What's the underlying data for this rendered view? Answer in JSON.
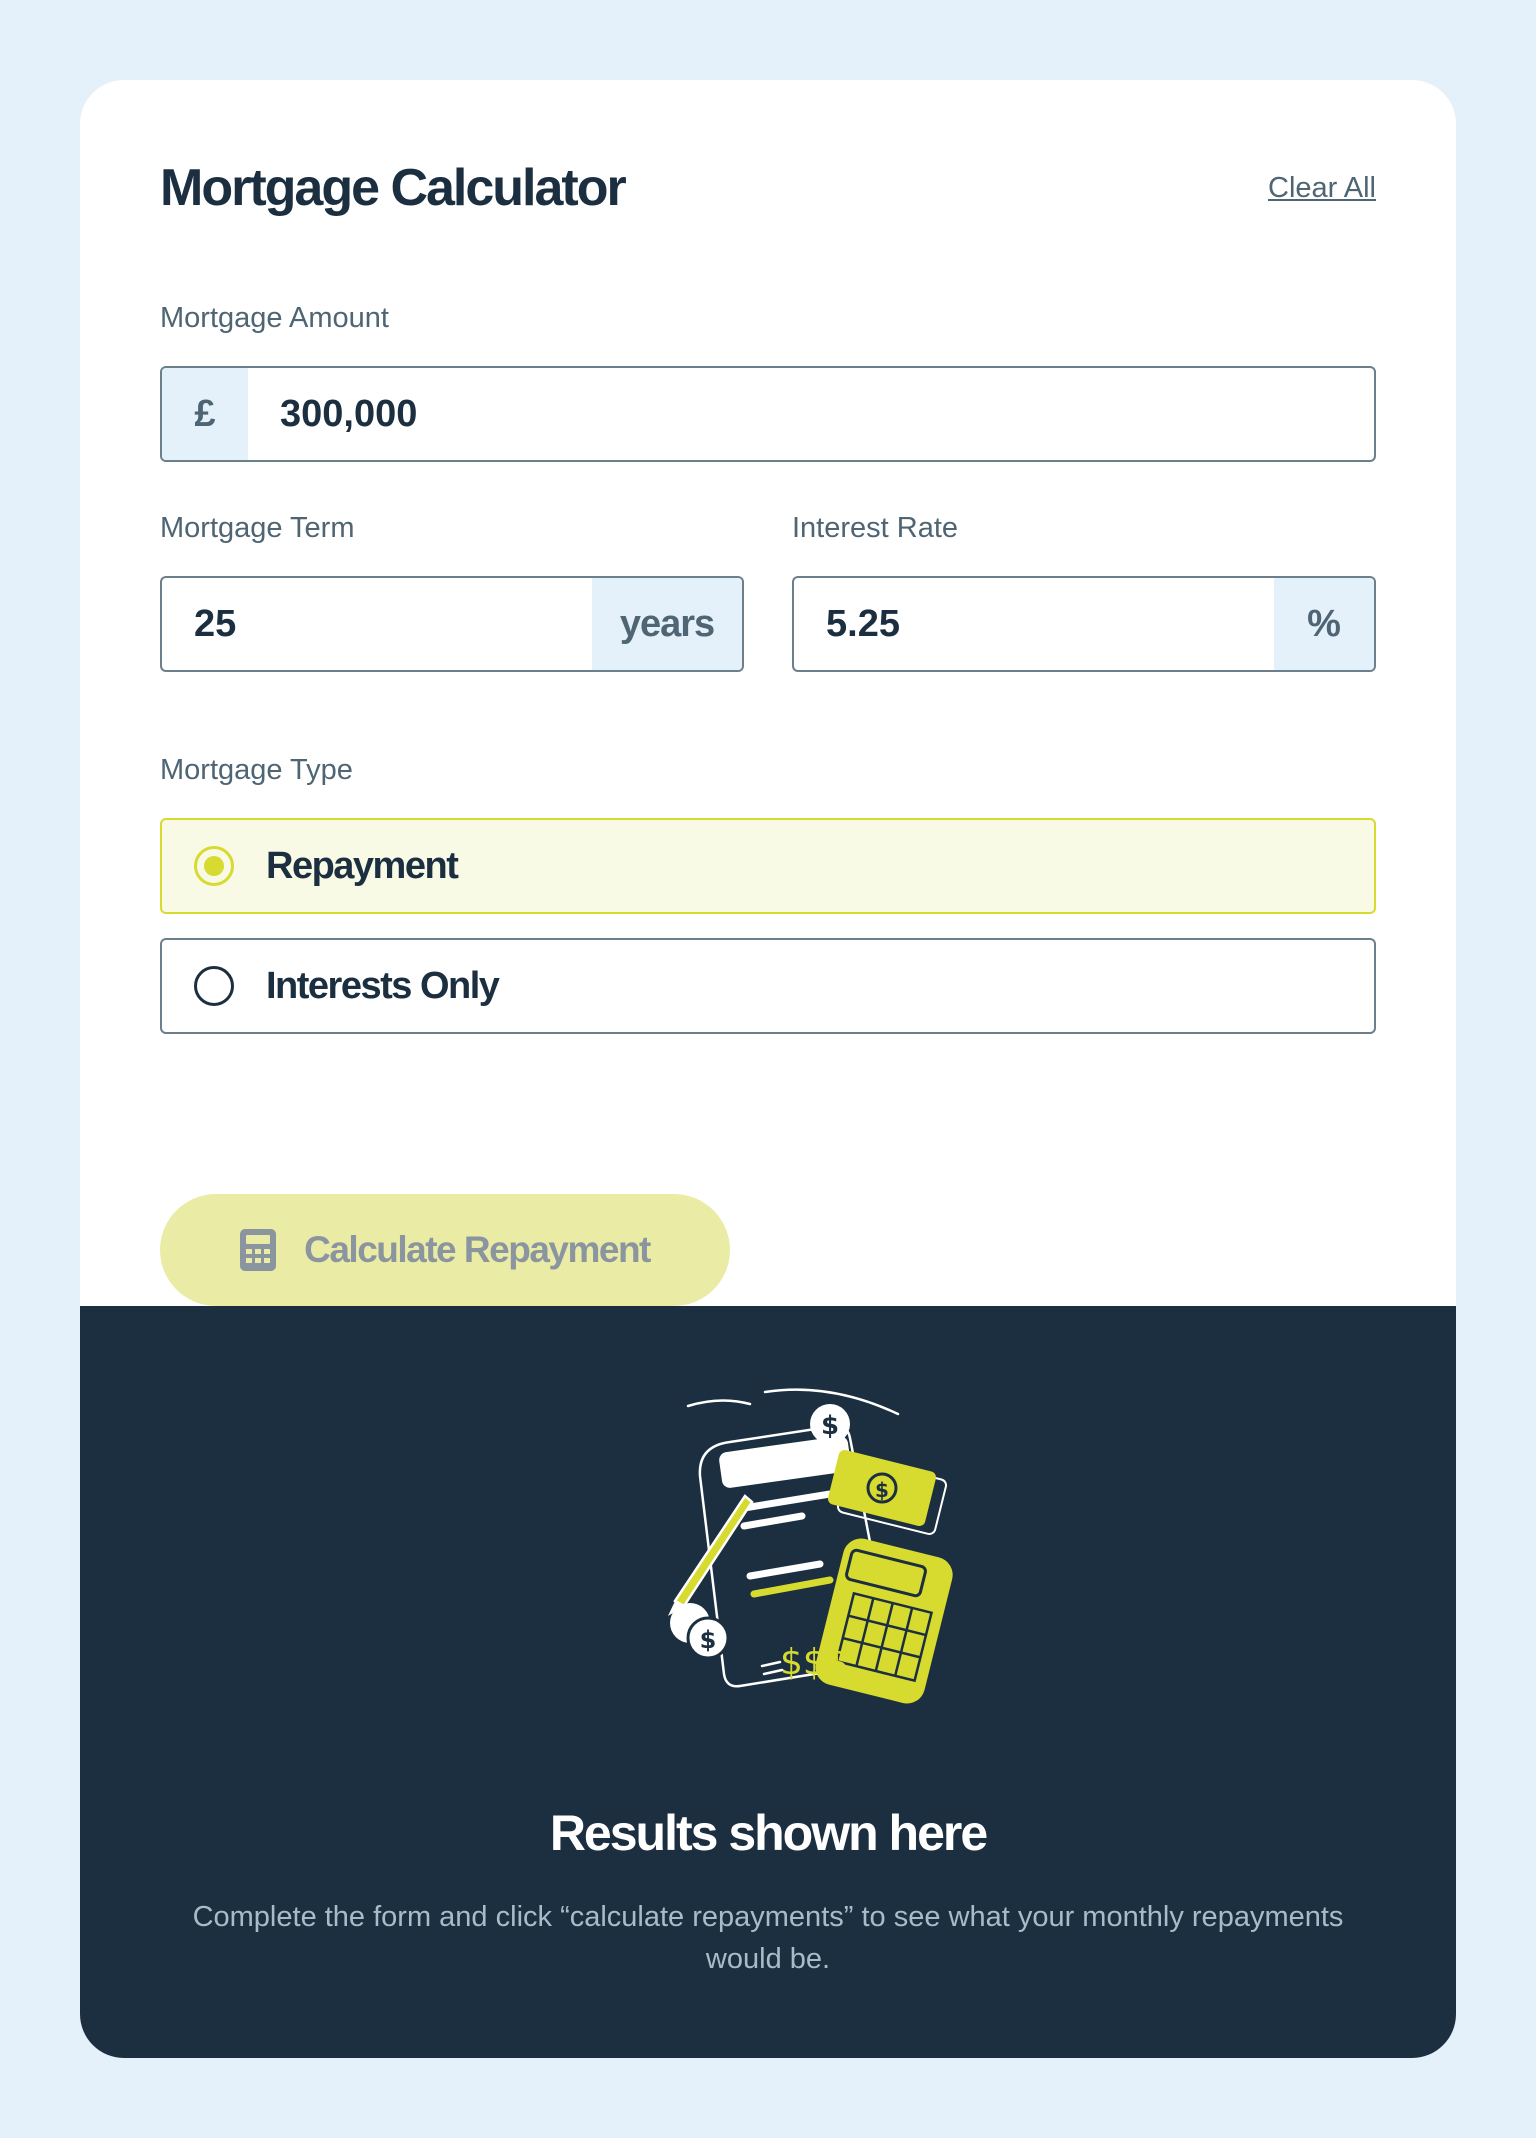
{
  "header": {
    "title": "Mortgage Calculator",
    "clear_label": "Clear All"
  },
  "amount": {
    "label": "Mortgage Amount",
    "prefix": "£",
    "value": "300,000"
  },
  "term": {
    "label": "Mortgage Term",
    "value": "25",
    "suffix": "years"
  },
  "rate": {
    "label": "Interest Rate",
    "value": "5.25",
    "suffix": "%"
  },
  "type": {
    "label": "Mortgage Type",
    "options": [
      {
        "label": "Repayment",
        "selected": true
      },
      {
        "label": "Interests Only",
        "selected": false
      }
    ]
  },
  "button": {
    "label": "Calculate Repayment",
    "icon": "calculator-icon"
  },
  "results": {
    "title": "Results shown here",
    "text": "Complete the form and click “calculate repayments” to see what your monthly repayments would be."
  },
  "colors": {
    "lime": "#d7da2f",
    "navy": "#1b2f40",
    "slate": "#4f6574",
    "sky": "#e4f1fb"
  }
}
